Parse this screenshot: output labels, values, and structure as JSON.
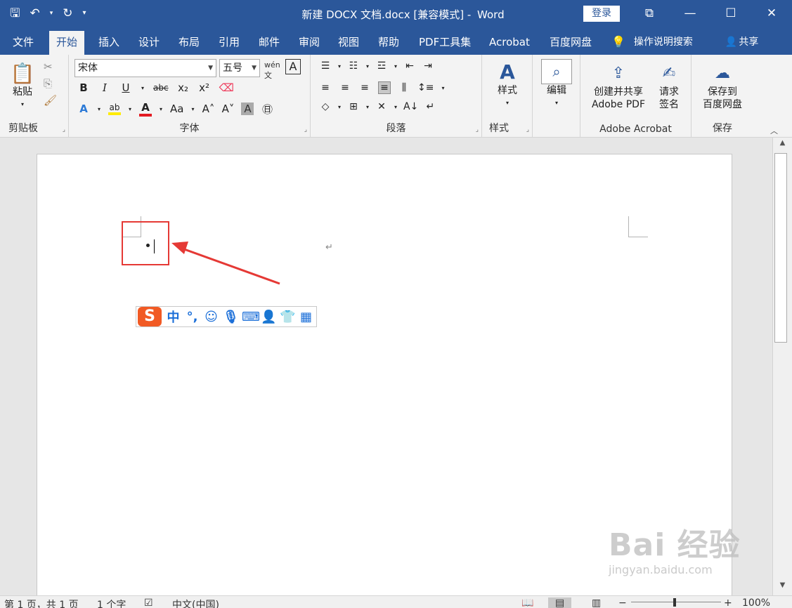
{
  "window": {
    "title": "新建 DOCX 文档.docx [兼容模式]",
    "app_name": "Word",
    "login_label": "登录",
    "controls": [
      "ribbon-display-icon",
      "minimize-icon",
      "maximize-icon",
      "close-icon"
    ]
  },
  "quick_access": [
    "save-icon",
    "undo-icon",
    "redo-icon",
    "customize-icon"
  ],
  "tabs": [
    {
      "label": "文件"
    },
    {
      "label": "开始",
      "active": true
    },
    {
      "label": "插入"
    },
    {
      "label": "设计"
    },
    {
      "label": "布局"
    },
    {
      "label": "引用"
    },
    {
      "label": "邮件"
    },
    {
      "label": "审阅"
    },
    {
      "label": "视图"
    },
    {
      "label": "帮助"
    },
    {
      "label": "PDF工具集"
    },
    {
      "label": "Acrobat"
    },
    {
      "label": "百度网盘"
    }
  ],
  "tell_me": "操作说明搜索",
  "share": "共享",
  "ribbon": {
    "clipboard": {
      "label": "剪贴板",
      "paste": "粘贴"
    },
    "font": {
      "label": "字体",
      "font_name": "宋体",
      "font_size": "五号"
    },
    "paragraph": {
      "label": "段落"
    },
    "styles": {
      "label": "样式",
      "button": "样式"
    },
    "editing": {
      "button": "编辑"
    },
    "acrobat": {
      "label": "Adobe Acrobat",
      "create_share_line1": "创建并共享",
      "create_share_line2": "Adobe PDF",
      "sign_line1": "请求",
      "sign_line2": "签名"
    },
    "save": {
      "label": "保存",
      "save_to_line1": "保存到",
      "save_to_line2": "百度网盘"
    }
  },
  "ime_toolbar": {
    "logo": "S",
    "mode": "中",
    "punct": "°,"
  },
  "statusbar": {
    "page": "第 1 页，共 1 页",
    "words": "1 个字",
    "language": "中文(中国)",
    "zoom": "100%"
  },
  "watermark": {
    "main": "Bai 经验",
    "sub": "jingyan.baidu.com"
  },
  "colors": {
    "brand": "#2b579a",
    "highlight_box": "#e53935",
    "ime_logo": "#f15a24"
  }
}
